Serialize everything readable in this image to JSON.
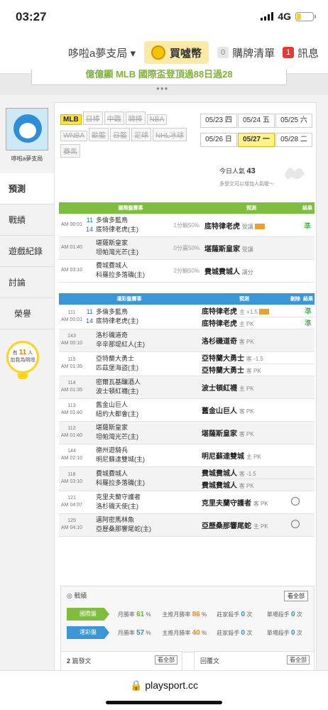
{
  "status": {
    "time": "03:27",
    "network": "4G"
  },
  "topnav": {
    "dropdown": "哆啦a夢支局 ▾",
    "buy_coin": "買噓幣",
    "cart_count": "0",
    "cart": "購牌清單",
    "msg_count": "1",
    "messages": "訊息"
  },
  "banner": {
    "text": "億億顯 MLB 國際盃登頂過88日過28"
  },
  "sidebar": {
    "username": "哆啦a夢支局",
    "items": [
      "預測",
      "戰績",
      "遊戲紀錄",
      "討論",
      "榮譽"
    ],
    "bulb_prefix": "有",
    "bulb_count": "11",
    "bulb_unit": "人",
    "bulb_note": "加我為明燈"
  },
  "leagues": [
    {
      "label": "MLB",
      "on": true
    },
    {
      "label": "日棒"
    },
    {
      "label": "中職"
    },
    {
      "label": "韓棒"
    },
    {
      "label": "NBA"
    },
    {
      "label": "WNBA"
    },
    {
      "label": "歐籃"
    },
    {
      "label": "日籃"
    },
    {
      "label": "足球"
    },
    {
      "label": "NHL冰球"
    },
    {
      "label": "賽馬"
    }
  ],
  "dates": [
    {
      "label": "05/23 四"
    },
    {
      "label": "05/24 五"
    },
    {
      "label": "05/25 六"
    },
    {
      "label": "05/26 日"
    },
    {
      "label": "05/27 一",
      "on": true
    },
    {
      "label": "05/28 二"
    }
  ],
  "popular": {
    "label": "今日人氣",
    "value": "43",
    "note": "多發文可以增加人氣喔～"
  },
  "intl": {
    "headers": [
      "國際盤賽事",
      "預測",
      "結果"
    ],
    "rows": [
      {
        "time": "AM 00:01",
        "n1": "11",
        "n2": "14",
        "t1": "多倫多藍鳥",
        "t2": "底特律老虎(主)",
        "odds": "1分輸50%",
        "pick": "底特律老虎",
        "type": "受讓",
        "tag": true,
        "result": "準"
      },
      {
        "time": "AM 01:40",
        "t1": "堪薩斯皇家",
        "t2": "坦帕灣光芒(主)",
        "odds": "0分贏50%",
        "pick": "堪薩斯皇家",
        "type": "受讓",
        "result": ""
      },
      {
        "time": "AM 03:10",
        "t1": "費城費城人",
        "t2": "科羅拉多落磯(主)",
        "odds": "2分輸50%",
        "pick": "費城費城人",
        "type": "讓分",
        "result": ""
      }
    ]
  },
  "local": {
    "headers": [
      "運彩盤賽事",
      "預測",
      "刪除",
      "結果"
    ],
    "rows": [
      {
        "id": "111",
        "time": "AM 00:01",
        "n1": "11",
        "n2": "14",
        "t1": "多倫多藍鳥",
        "t2": "底特律老虎(主)",
        "picks": [
          {
            "p": "底特律老虎",
            "s": "主 +1.5",
            "tag": true,
            "r": "準"
          },
          {
            "p": "底特律老虎",
            "s": "主 PK",
            "r": "準"
          }
        ]
      },
      {
        "id": "143",
        "time": "AM 00:10",
        "t1": "洛杉磯道奇",
        "t2": "辛辛那堤紅人(主)",
        "picks": [
          {
            "p": "洛杉磯道奇",
            "s": "客 PK"
          }
        ]
      },
      {
        "id": "115",
        "time": "AM 01:35",
        "t1": "亞特蘭大勇士",
        "t2": "匹茲堡海盜(主)",
        "picks": [
          {
            "p": "亞特蘭大勇士",
            "s": "客 -1.5"
          },
          {
            "p": "亞特蘭大勇士",
            "s": "客 PK"
          }
        ]
      },
      {
        "id": "114",
        "time": "AM 01:35",
        "t1": "密爾瓦基釀酒人",
        "t2": "波士頓紅襪(主)",
        "picks": [
          {
            "p": "波士頓紅襪",
            "s": "主 PK"
          }
        ]
      },
      {
        "id": "113",
        "time": "AM 01:40",
        "t1": "舊金山巨人",
        "t2": "紐約大都會(主)",
        "picks": [
          {
            "p": "舊金山巨人",
            "s": "客 PK"
          }
        ]
      },
      {
        "id": "112",
        "time": "AM 01:40",
        "t1": "堪薩斯皇家",
        "t2": "坦帕灣光芒(主)",
        "picks": [
          {
            "p": "堪薩斯皇家",
            "s": "客 PK"
          }
        ]
      },
      {
        "id": "144",
        "time": "AM 02:10",
        "t1": "德州遊騎兵",
        "t2": "明尼蘇達雙城(主)",
        "picks": [
          {
            "p": "明尼蘇達雙城",
            "s": "主 PK"
          }
        ]
      },
      {
        "id": "118",
        "time": "AM 03:10",
        "t1": "費城費城人",
        "t2": "科羅拉多落磯(主)",
        "picks": [
          {
            "p": "費城費城人",
            "s": "客 -1.5"
          },
          {
            "p": "費城費城人",
            "s": "客 PK"
          }
        ]
      },
      {
        "id": "121",
        "time": "AM 04:07",
        "t1": "克里夫蘭守護者",
        "t2": "洛杉磯天使(主)",
        "picks": [
          {
            "p": "克里夫蘭守護者",
            "s": "客 PK",
            "del": true
          }
        ]
      },
      {
        "id": "125",
        "time": "AM 04:10",
        "t1": "邁阿密馬林魚",
        "t2": "亞歷桑那響尾蛇(主)",
        "picks": [
          {
            "p": "亞歷桑那響尾蛇",
            "s": "主 PK",
            "del": true
          }
        ]
      }
    ]
  },
  "stats": {
    "title": "戰績",
    "all": "看全部",
    "rows": [
      {
        "label": "國際盤",
        "color": "#7fbd3f",
        "m1": "月勝率",
        "v1": "61",
        "m2": "主推月勝率",
        "v2": "86",
        "m3": "莊家殺手",
        "v3": "0",
        "m4": "單場殺手",
        "v4": "0"
      },
      {
        "label": "運彩盤",
        "color": "#3a96d6",
        "m1": "月勝率",
        "v1": "57",
        "m2": "主推月勝率",
        "v2": "40",
        "m3": "莊家殺手",
        "v3": "0",
        "m4": "單場殺手",
        "v4": "0"
      }
    ]
  },
  "bottom": {
    "left_num": "2",
    "left_label": "篇發文",
    "left_btn": "看全部",
    "right_label": "回覆文",
    "right_btn": "看全部"
  },
  "url": "playsport.cc"
}
